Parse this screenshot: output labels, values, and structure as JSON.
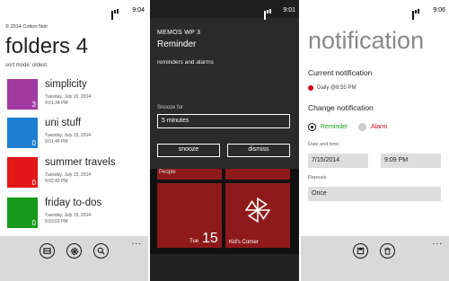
{
  "screen1": {
    "status_time": "9:04",
    "copyright": "© 2014 Cotton Noir",
    "title": "folders 4",
    "sort_mode": "sort mode: oldest",
    "folders": [
      {
        "name": "simplicity",
        "date": "Tuesday, July 15, 2014",
        "time": "9:01:34 PM",
        "count": "3",
        "color": "#a03aa0"
      },
      {
        "name": "uni stuff",
        "date": "Tuesday, July 15, 2014",
        "time": "9:01:46 PM",
        "count": "0",
        "color": "#1e7fd1"
      },
      {
        "name": "summer travels",
        "date": "Tuesday, July 15, 2014",
        "time": "9:02:42 PM",
        "count": "0",
        "color": "#e21818"
      },
      {
        "name": "friday to-dos",
        "date": "Tuesday, July 15, 2014",
        "time": "9:03:03 PM",
        "count": "0",
        "color": "#179a1c"
      }
    ],
    "appbar_icons": [
      "folders-icon",
      "pinwheel-icon",
      "search-icon"
    ],
    "more": "..."
  },
  "screen2": {
    "status_time": "9:01",
    "app_name": "MEMOS WP 3",
    "title": "Reminder",
    "description": "reminders and alarms",
    "snooze_label": "Snooze for",
    "snooze_value": "5 minutes",
    "snooze_button": "snooze",
    "dismiss_button": "dismiss",
    "tile_people": "People",
    "tile_date_day": "Tue",
    "tile_date_num": "15",
    "tile_kids": "Kid's Corner"
  },
  "screen3": {
    "status_time": "9:06",
    "title": "notification",
    "current_label": "Current notification",
    "current_value": "Daily @8:55 PM",
    "current_dot_color": "#d0021b",
    "change_label": "Change notification",
    "option_reminder": "Reminder",
    "option_alarm": "Alarm",
    "reminder_color": "#179a1c",
    "alarm_color": "#d0021b",
    "datetime_label": "Date and time",
    "date_value": "7/15/2014",
    "time_value": "9:09 PM",
    "repeats_label": "Repeats",
    "repeats_value": "Once",
    "appbar_icons": [
      "save-icon",
      "delete-icon"
    ],
    "more": "..."
  }
}
